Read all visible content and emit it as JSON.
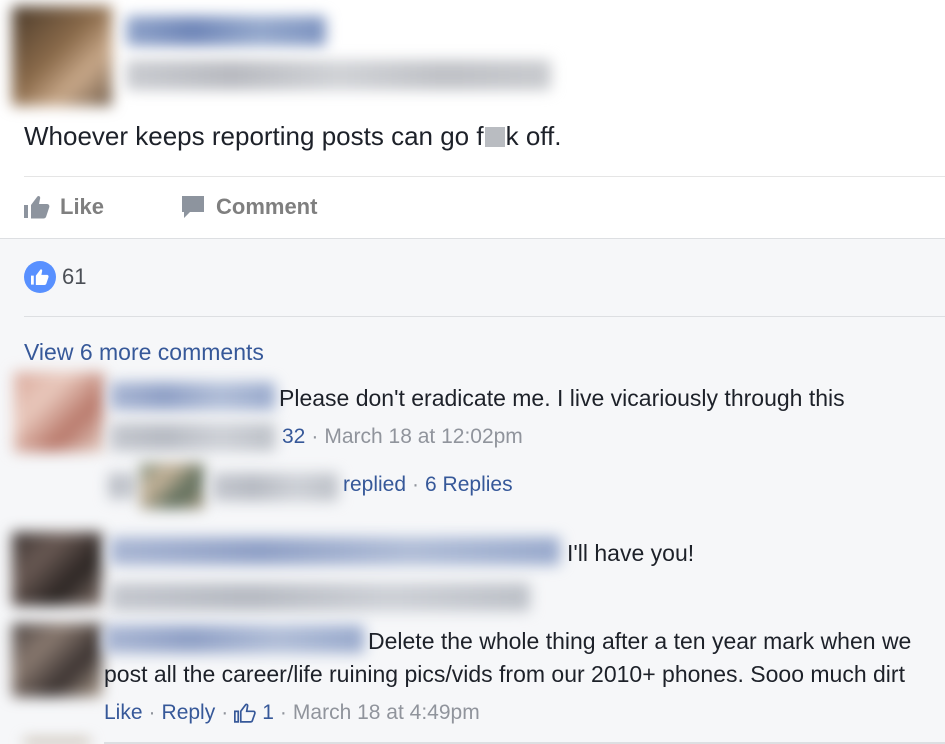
{
  "post": {
    "text_before": "Whoever keeps reporting posts can go f",
    "text_after": "k off.",
    "actions": {
      "like": "Like",
      "comment": "Comment"
    }
  },
  "reactions": {
    "count": "61"
  },
  "view_more": "View 6 more comments",
  "comments": [
    {
      "text": "Please don't eradicate me. I live vicariously through this",
      "like_count": "32",
      "sep": "·",
      "timestamp": "March 18 at 12:02pm",
      "replies": {
        "prefix": "replied",
        "sep": "·",
        "count_label": "6 Replies"
      }
    },
    {
      "text": "I'll have you!"
    },
    {
      "text_line1": "Delete the whole thing after a ten year mark when we",
      "text_line2": "post all the career/life ruining pics/vids from our 2010+ phones. Sooo much dirt",
      "like_label": "Like",
      "reply_label": "Reply",
      "like_count": "1",
      "sep": "·",
      "timestamp": "March 18 at 4:49pm"
    }
  ],
  "colors": {
    "link": "#365899",
    "like_badge": "#5890ff",
    "muted": "#90949c",
    "feedback_bg": "#f6f7f9"
  }
}
